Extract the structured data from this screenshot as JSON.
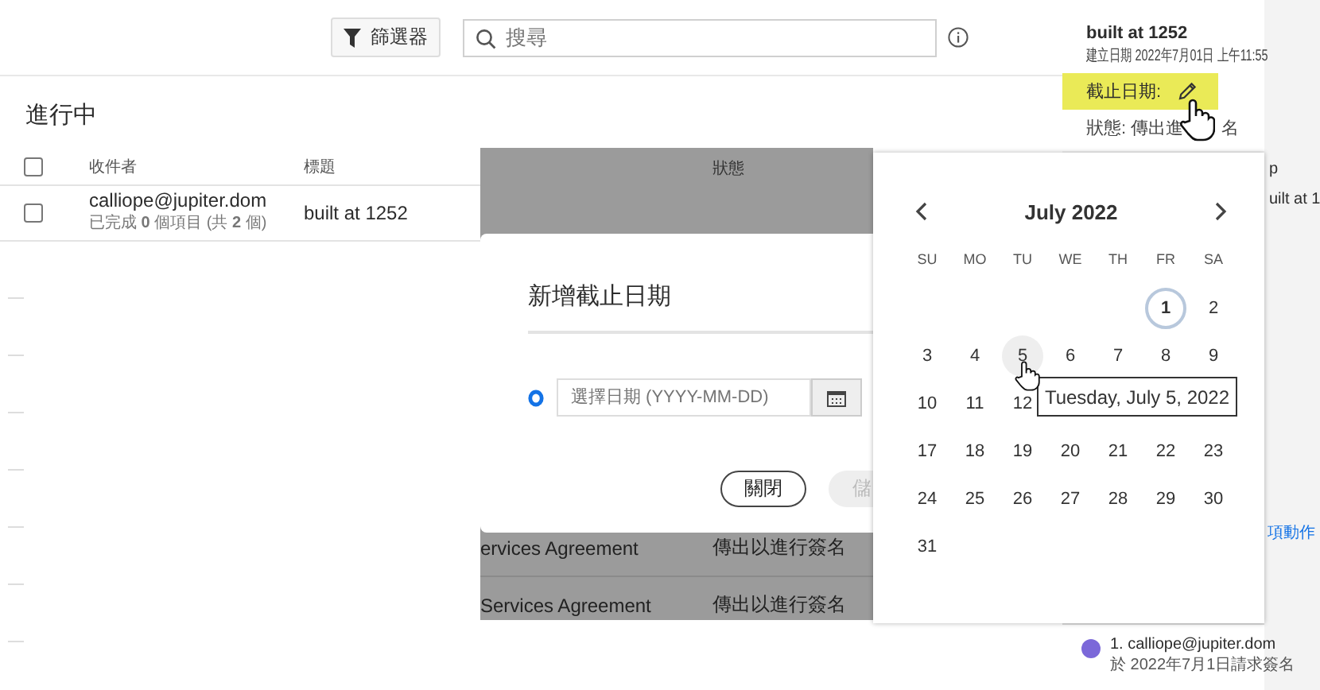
{
  "toolbar": {
    "filter_button": "篩選器",
    "search": {
      "placeholder": "搜尋"
    }
  },
  "section_title": "進行中",
  "table": {
    "select_all_checked": false,
    "columns": [
      "收件者",
      "標題",
      "狀態"
    ],
    "rows": [
      {
        "recipient": "calliope@jupiter.dom",
        "progress": "已完成 **0** 個項目 (共 **2** 個)",
        "title": "built at 1252",
        "checked": false
      }
    ],
    "masked_rows": [
      {
        "title": "ervices Agreement",
        "status": "傳出以進行簽名"
      },
      {
        "title": "Services Agreement",
        "status": "傳出以進行簽名"
      }
    ]
  },
  "dialog": {
    "title": "新增截止日期",
    "date_field": {
      "placeholder": "選擇日期 (YYYY-MM-DD)"
    },
    "buttons": [
      {
        "label": "關閉",
        "disabled": false
      },
      {
        "label": "儲",
        "disabled": true
      }
    ]
  },
  "calendar": {
    "month": "July 2022",
    "weekdays": [
      "SU",
      "MO",
      "TU",
      "WE",
      "TH",
      "FR",
      "SA"
    ],
    "weeks": [
      [
        {
          "label": "1",
          "today": true,
          "hovered": false
        },
        {
          "label": "2",
          "today": false,
          "hovered": false
        }
      ],
      [
        {
          "label": "3",
          "today": false,
          "hovered": false
        },
        {
          "label": "4",
          "today": false,
          "hovered": false
        },
        {
          "label": "5",
          "today": false,
          "hovered": true
        },
        {
          "label": "6",
          "today": false,
          "hovered": false
        },
        {
          "label": "7",
          "today": false,
          "hovered": false
        },
        {
          "label": "8",
          "today": false,
          "hovered": false
        },
        {
          "label": "9",
          "today": false,
          "hovered": false
        }
      ],
      [
        {
          "label": "10",
          "today": false,
          "hovered": false
        },
        {
          "label": "11",
          "today": false,
          "hovered": false
        },
        {
          "label": "12",
          "today": false,
          "hovered": false
        }
      ],
      [
        {
          "label": "17",
          "today": false,
          "hovered": false
        },
        {
          "label": "18",
          "today": false,
          "hovered": false
        },
        {
          "label": "19",
          "today": false,
          "hovered": false
        },
        {
          "label": "20",
          "today": false,
          "hovered": false
        },
        {
          "label": "21",
          "today": false,
          "hovered": false
        },
        {
          "label": "22",
          "today": false,
          "hovered": false
        },
        {
          "label": "23",
          "today": false,
          "hovered": false
        }
      ],
      [
        {
          "label": "24",
          "today": false,
          "hovered": false
        },
        {
          "label": "25",
          "today": false,
          "hovered": false
        },
        {
          "label": "26",
          "today": false,
          "hovered": false
        },
        {
          "label": "27",
          "today": false,
          "hovered": false
        },
        {
          "label": "28",
          "today": false,
          "hovered": false
        },
        {
          "label": "29",
          "today": false,
          "hovered": false
        },
        {
          "label": "30",
          "today": false,
          "hovered": false
        }
      ],
      [
        {
          "label": "31",
          "today": false,
          "hovered": false
        }
      ]
    ],
    "tooltip": "Tuesday, July 5, 2022"
  },
  "sidebar": {
    "card": {
      "title": "built at 1252",
      "created": "建立日期 2022年7月01日 上午11:55",
      "due_label": "截止日期:",
      "due_highlighted": true,
      "status_parts": [
        "狀態: 傳出進",
        "名"
      ]
    },
    "partial_texts": [
      "p",
      "uilt at 1"
    ],
    "link": "項動作",
    "signer": {
      "name": "1. calliope@jupiter.dom",
      "note": "於 2022年7月1日請求簽名",
      "color": "#7b68d9"
    }
  }
}
